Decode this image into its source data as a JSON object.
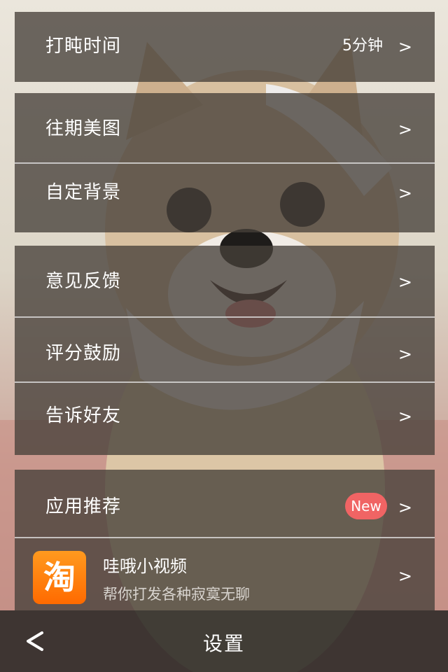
{
  "settings": {
    "nap_time": {
      "label": "打盹时间",
      "value": "5分钟",
      "chevron": ">"
    },
    "gallery": {
      "label": "往期美图",
      "chevron": ">"
    },
    "custom_bg": {
      "label": "自定背景",
      "chevron": ">"
    },
    "feedback": {
      "label": "意见反馈",
      "chevron": ">"
    },
    "rate": {
      "label": "评分鼓励",
      "chevron": ">"
    },
    "share": {
      "label": "告诉好友",
      "chevron": ">"
    },
    "recommend": {
      "label": "应用推荐",
      "badge": "New",
      "chevron": ">"
    },
    "app_promo": {
      "icon_text": "淘",
      "title": "哇哦小视频",
      "subtitle": "帮你打发各种寂寞无聊",
      "chevron": ">"
    }
  },
  "navbar": {
    "title": "设置",
    "back_icon": "chevron-left-icon"
  },
  "colors": {
    "badge": "#f06464",
    "app_icon": "#ff7a00"
  }
}
